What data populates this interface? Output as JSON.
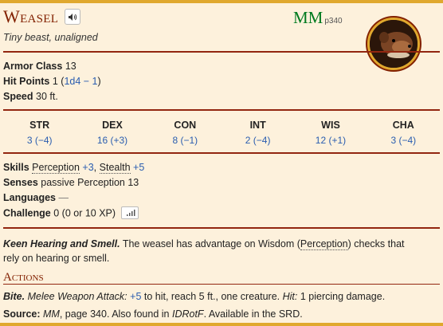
{
  "creature": {
    "name": "Weasel",
    "book": "MM",
    "page": "p340",
    "subtitle": "Tiny beast, unaligned"
  },
  "stats": {
    "armor_class_label": "Armor Class",
    "armor_class_value": "13",
    "hit_points_label": "Hit Points",
    "hit_points_value": "1",
    "hit_points_open": "(",
    "hit_points_dice": "1d4 − 1",
    "hit_points_close": ")",
    "speed_label": "Speed",
    "speed_value": "30 ft."
  },
  "abilities": [
    {
      "name": "STR",
      "value": "3 (−4)"
    },
    {
      "name": "DEX",
      "value": "16 (+3)"
    },
    {
      "name": "CON",
      "value": "8 (−1)"
    },
    {
      "name": "INT",
      "value": "2 (−4)"
    },
    {
      "name": "WIS",
      "value": "12 (+1)"
    },
    {
      "name": "CHA",
      "value": "3 (−4)"
    }
  ],
  "traits": {
    "skills_label": "Skills",
    "skill1_name": "Perception",
    "skill1_bonus": "+3",
    "skill_sep": ",",
    "skill2_name": "Stealth",
    "skill2_bonus": "+5",
    "senses_label": "Senses",
    "senses_value": "passive Perception 13",
    "languages_label": "Languages",
    "languages_value": "—",
    "challenge_label": "Challenge",
    "challenge_value": "0 (0 or 10 XP)"
  },
  "feature": {
    "title": "Keen Hearing and Smell.",
    "text1": "The weasel has advantage on Wisdom (",
    "link": "Perception",
    "text2": ") checks that",
    "text3": "rely on hearing or smell."
  },
  "actions": {
    "heading": "Actions",
    "bite_name": "Bite.",
    "attack_type": "Melee Weapon Attack:",
    "attack_bonus": "+5",
    "attack_text": "to hit, reach 5 ft., one creature.",
    "hit_label": "Hit:",
    "hit_text": "1 piercing damage."
  },
  "source": {
    "label": "Source:",
    "book": "MM",
    "text1": ", page 340. Also found in",
    "other_book": "IDRotF",
    "text2": ". Available in the SRD."
  },
  "colors": {
    "accent": "#822000",
    "rule": "#922610",
    "book": "#007a1f",
    "link": "#2a5db0",
    "gold": "#e0a82e",
    "background": "#fdf1dc"
  }
}
